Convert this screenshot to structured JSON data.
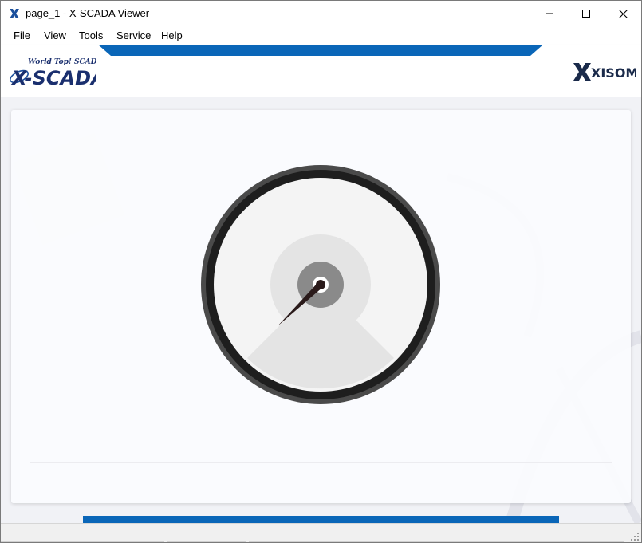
{
  "window": {
    "title": "page_1 - X-SCADA Viewer",
    "minimize_glyph": "minimize-icon",
    "maximize_glyph": "maximize-icon",
    "close_glyph": "close-icon"
  },
  "menu": {
    "items": [
      {
        "label": "File"
      },
      {
        "label": "View"
      },
      {
        "label": "Tools"
      },
      {
        "label": "Service"
      },
      {
        "label": "Help"
      }
    ]
  },
  "header": {
    "logo_left": {
      "tagline": "World Top! SCADA Solution",
      "brand": "X-SCADA"
    },
    "logo_right": {
      "brand": "XISOM"
    }
  },
  "gauge": {
    "needle_angle_deg": 225
  },
  "colors": {
    "accent_blue": "#0a66b8",
    "gauge_ring_outer": "#4a4a4a",
    "gauge_ring_inner": "#1e1e1e",
    "gauge_face": "#f4f4f4",
    "gauge_wedge": "#e4e4e4",
    "needle": "#2a1a1a"
  }
}
